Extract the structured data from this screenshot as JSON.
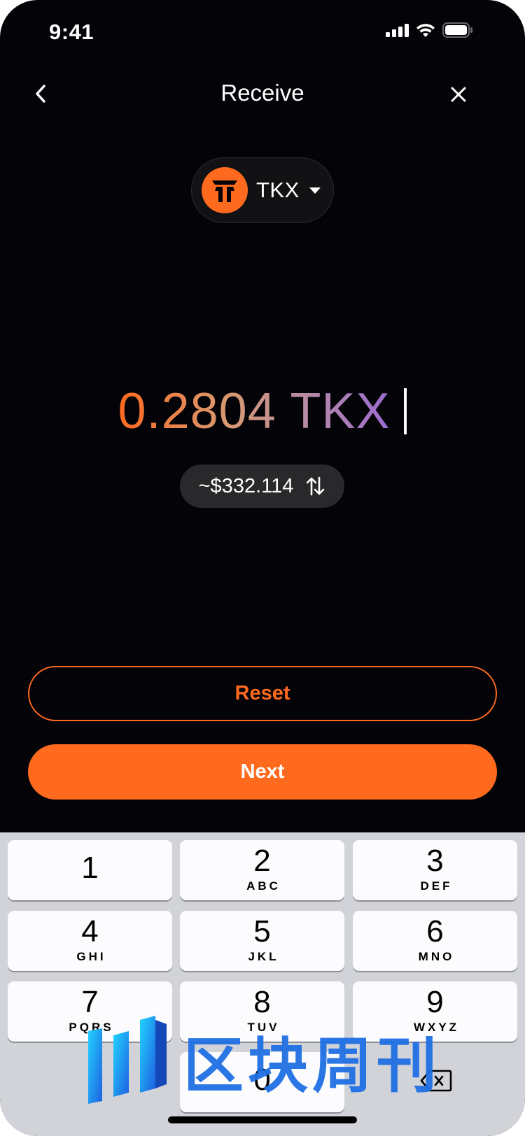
{
  "status_bar": {
    "time": "9:41"
  },
  "header": {
    "title": "Receive"
  },
  "token": {
    "symbol": "TKX"
  },
  "amount": {
    "value": "0.2804 TKX",
    "fiat": "~$332.114"
  },
  "buttons": {
    "reset": "Reset",
    "next": "Next"
  },
  "keyboard": {
    "keys": [
      {
        "num": "1",
        "letters": ""
      },
      {
        "num": "2",
        "letters": "ABC"
      },
      {
        "num": "3",
        "letters": "DEF"
      },
      {
        "num": "4",
        "letters": "GHI"
      },
      {
        "num": "5",
        "letters": "JKL"
      },
      {
        "num": "6",
        "letters": "MNO"
      },
      {
        "num": "7",
        "letters": "PQRS"
      },
      {
        "num": "8",
        "letters": "TUV"
      },
      {
        "num": "9",
        "letters": "WXYZ"
      },
      {
        "num": "0",
        "letters": ""
      }
    ]
  },
  "watermark": {
    "text": "区块周刊"
  },
  "colors": {
    "accent": "#ff6a1f",
    "background": "#040307",
    "keyboard": "#d1d3d9"
  },
  "icons": [
    "back-chevron-icon",
    "close-icon",
    "token-logo-icon",
    "caret-down-icon",
    "swap-arrows-icon",
    "delete-key-icon",
    "signal-icon",
    "wifi-icon",
    "battery-icon"
  ]
}
